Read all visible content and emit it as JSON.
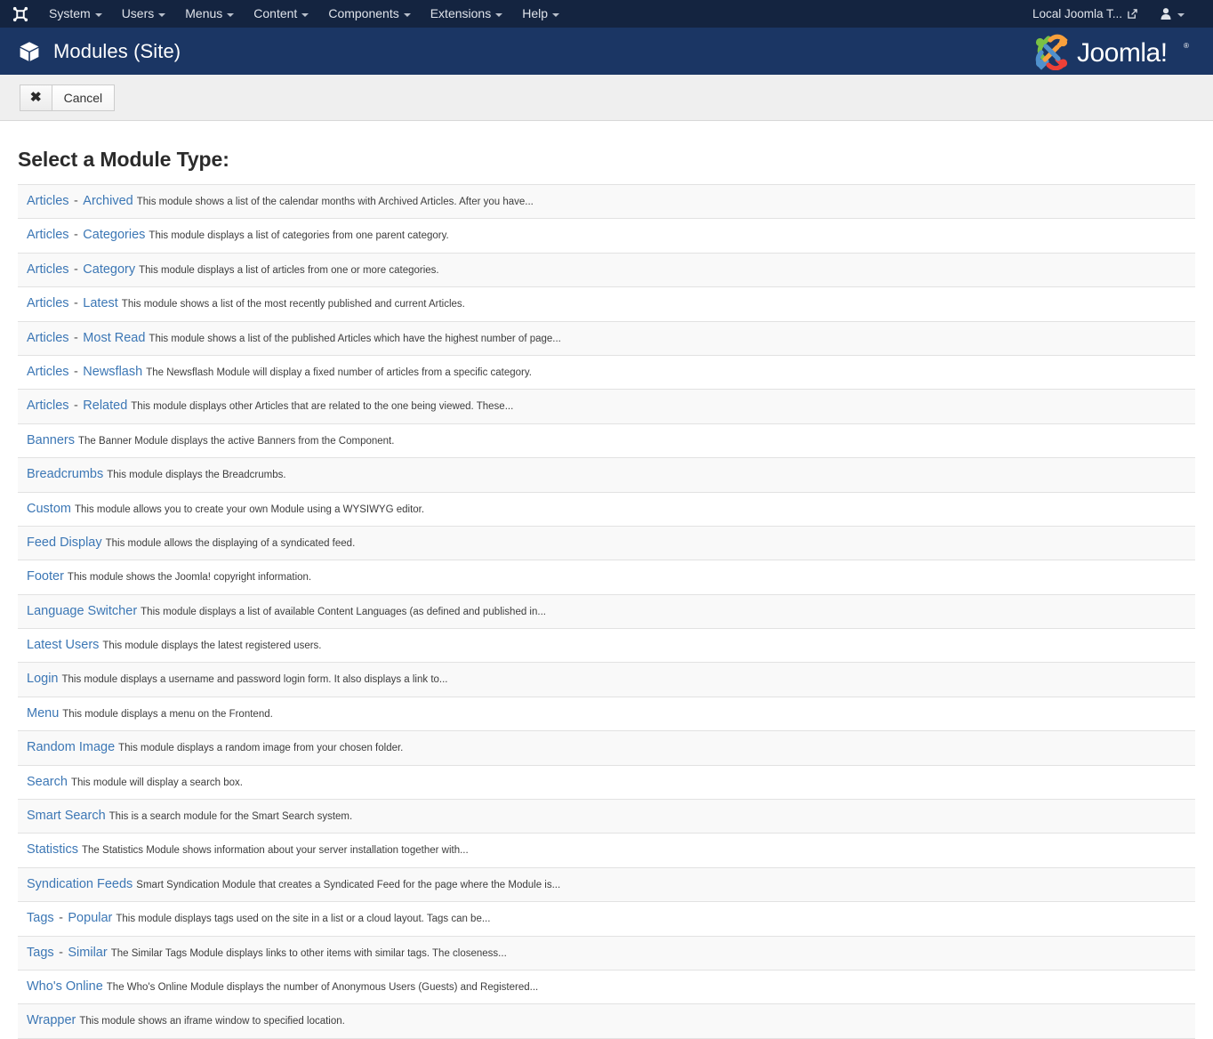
{
  "topnav": {
    "brand_icon": "joomla-logo-mark-icon",
    "items": [
      {
        "label": "System",
        "icon": "chevron-down-icon"
      },
      {
        "label": "Users",
        "icon": "chevron-down-icon"
      },
      {
        "label": "Menus",
        "icon": "chevron-down-icon"
      },
      {
        "label": "Content",
        "icon": "chevron-down-icon"
      },
      {
        "label": "Components",
        "icon": "chevron-down-icon"
      },
      {
        "label": "Extensions",
        "icon": "chevron-down-icon"
      },
      {
        "label": "Help",
        "icon": "chevron-down-icon"
      }
    ],
    "site_link_label": "Local Joomla T...",
    "site_link_icon": "external-link-icon",
    "user_icon": "person-icon",
    "user_caret_icon": "chevron-down-icon"
  },
  "header": {
    "icon": "cube-module-icon",
    "title": "Modules (Site)",
    "logo_text": "Joomla!",
    "logo_name": "joomla-brand-logo"
  },
  "toolbar": {
    "cancel_icon": "close-x-icon",
    "cancel_label": "Cancel"
  },
  "main": {
    "heading": "Select a Module Type:"
  },
  "colors": {
    "topnav_bg": "#142440",
    "header_bg": "#1b3664",
    "toolbar_bg": "#efefef",
    "link": "#3c77b5",
    "row_odd_bg": "#f9f9f9",
    "row_even_bg": "#ffffff",
    "row_border": "#e2e2e2",
    "joomla_orange": "#f9a03c",
    "joomla_green": "#7ac143",
    "joomla_blue": "#5091cd",
    "joomla_red": "#ee4037"
  },
  "modules": [
    {
      "title": "Articles",
      "separator": "-",
      "subtitle": "Archived",
      "description": "This module shows a list of the calendar months with Archived Articles. After you have..."
    },
    {
      "title": "Articles",
      "separator": "-",
      "subtitle": "Categories",
      "description": "This module displays a list of categories from one parent category."
    },
    {
      "title": "Articles",
      "separator": "-",
      "subtitle": "Category",
      "description": "This module displays a list of articles from one or more categories."
    },
    {
      "title": "Articles",
      "separator": "-",
      "subtitle": "Latest",
      "description": "This module shows a list of the most recently published and current Articles."
    },
    {
      "title": "Articles",
      "separator": "-",
      "subtitle": "Most Read",
      "description": "This module shows a list of the published Articles which have the highest number of page..."
    },
    {
      "title": "Articles",
      "separator": "-",
      "subtitle": "Newsflash",
      "description": "The Newsflash Module will display a fixed number of articles from a specific category."
    },
    {
      "title": "Articles",
      "separator": "-",
      "subtitle": "Related",
      "description": "This module displays other Articles that are related to the one being viewed. These..."
    },
    {
      "title": "Banners",
      "separator": "",
      "subtitle": "",
      "description": "The Banner Module displays the active Banners from the Component."
    },
    {
      "title": "Breadcrumbs",
      "separator": "",
      "subtitle": "",
      "description": "This module displays the Breadcrumbs."
    },
    {
      "title": "Custom",
      "separator": "",
      "subtitle": "",
      "description": "This module allows you to create your own Module using a WYSIWYG editor."
    },
    {
      "title": "Feed Display",
      "separator": "",
      "subtitle": "",
      "description": "This module allows the displaying of a syndicated feed."
    },
    {
      "title": "Footer",
      "separator": "",
      "subtitle": "",
      "description": "This module shows the Joomla! copyright information."
    },
    {
      "title": "Language Switcher",
      "separator": "",
      "subtitle": "",
      "description": "This module displays a list of available Content Languages (as defined and published in..."
    },
    {
      "title": "Latest Users",
      "separator": "",
      "subtitle": "",
      "description": "This module displays the latest registered users."
    },
    {
      "title": "Login",
      "separator": "",
      "subtitle": "",
      "description": "This module displays a username and password login form. It also displays a link to..."
    },
    {
      "title": "Menu",
      "separator": "",
      "subtitle": "",
      "description": "This module displays a menu on the Frontend."
    },
    {
      "title": "Random Image",
      "separator": "",
      "subtitle": "",
      "description": "This module displays a random image from your chosen folder."
    },
    {
      "title": "Search",
      "separator": "",
      "subtitle": "",
      "description": "This module will display a search box."
    },
    {
      "title": "Smart Search",
      "separator": "",
      "subtitle": "",
      "description": "This is a search module for the Smart Search system."
    },
    {
      "title": "Statistics",
      "separator": "",
      "subtitle": "",
      "description": "The Statistics Module shows information about your server installation together with..."
    },
    {
      "title": "Syndication Feeds",
      "separator": "",
      "subtitle": "",
      "description": "Smart Syndication Module that creates a Syndicated Feed for the page where the Module is..."
    },
    {
      "title": "Tags",
      "separator": "-",
      "subtitle": "Popular",
      "description": "This module displays tags used on the site in a list or a cloud layout. Tags can be..."
    },
    {
      "title": "Tags",
      "separator": "-",
      "subtitle": "Similar",
      "description": "The Similar Tags Module displays links to other items with similar tags. The closeness..."
    },
    {
      "title": "Who's Online",
      "separator": "",
      "subtitle": "",
      "description": "The Who's Online Module displays the number of Anonymous Users (Guests) and Registered..."
    },
    {
      "title": "Wrapper",
      "separator": "",
      "subtitle": "",
      "description": "This module shows an iframe window to specified location."
    }
  ]
}
